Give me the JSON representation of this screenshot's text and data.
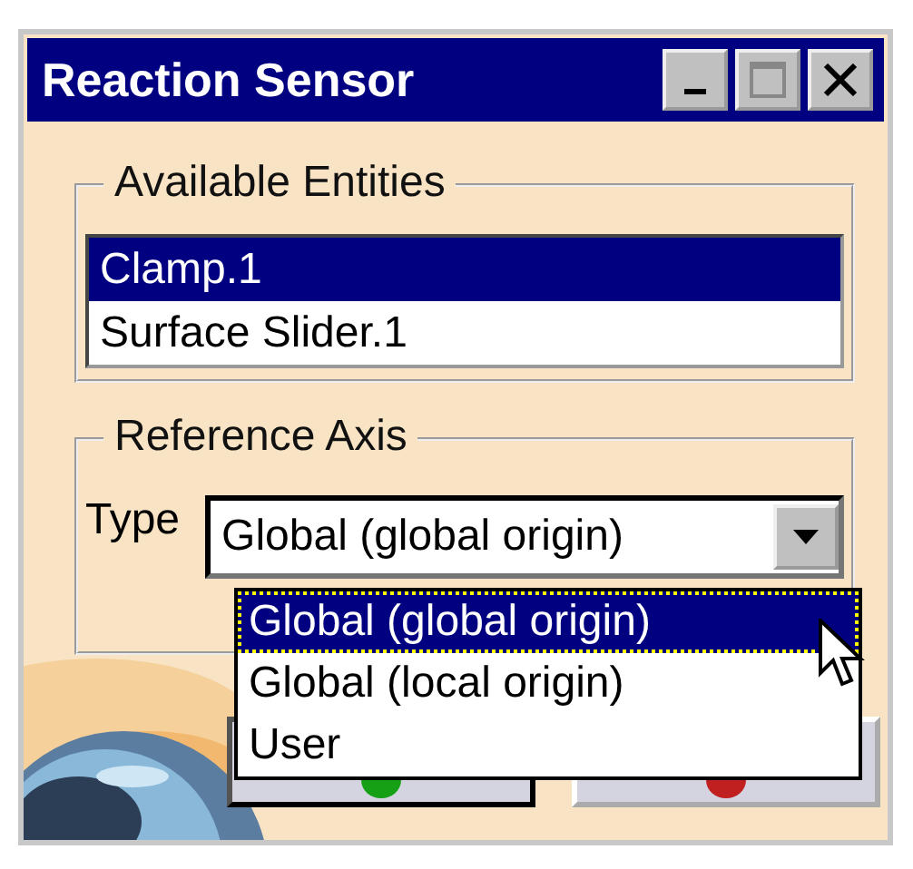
{
  "window": {
    "title": "Reaction Sensor"
  },
  "available_entities": {
    "title": "Available Entities",
    "items": [
      {
        "label": "Clamp.1",
        "selected": true
      },
      {
        "label": "Surface Slider.1",
        "selected": false
      }
    ]
  },
  "reference_axis": {
    "title": "Reference Axis",
    "type_label": "Type",
    "combo": {
      "value": "Global (global origin)",
      "expanded": true,
      "options": [
        {
          "label": "Global (global origin)",
          "selected": true
        },
        {
          "label": "Global (local origin)",
          "selected": false
        },
        {
          "label": "User",
          "selected": false
        }
      ]
    }
  },
  "buttons": [
    {
      "kind": "ok"
    },
    {
      "kind": "cancel"
    }
  ]
}
